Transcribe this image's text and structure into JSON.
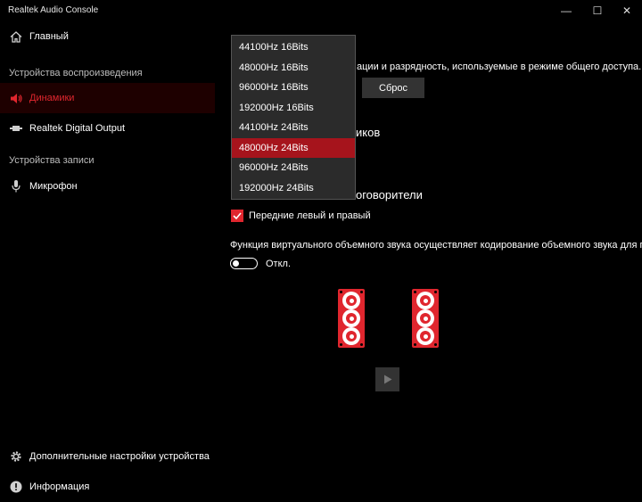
{
  "window": {
    "title": "Realtek Audio Console",
    "controls": [
      "—",
      "☐",
      "✕"
    ]
  },
  "sidebar": {
    "home": {
      "label": "Главный",
      "icon": "home-icon"
    },
    "playback_section": "Устройства воспроизведения",
    "playback_items": [
      {
        "label": "Динамики",
        "icon": "speaker-icon",
        "active": true
      },
      {
        "label": "Realtek Digital Output",
        "icon": "digital-output-icon",
        "active": false
      }
    ],
    "record_section": "Устройства записи",
    "record_items": [
      {
        "label": "Микрофон",
        "icon": "microphone-icon"
      }
    ],
    "bottom_items": [
      {
        "label": "Дополнительные настройки устройства",
        "icon": "gear-icon"
      },
      {
        "label": "Информация",
        "icon": "info-icon"
      }
    ]
  },
  "main": {
    "format_description": "ации и разрядность, используемые в режиме общего доступа.",
    "reset_label": "Сброс",
    "speaker_config_heading_partial": "иков",
    "fullrange_heading_partial": "оговорители",
    "front_lr_checkbox": {
      "label": "Передние левый и правый",
      "checked": true
    },
    "virtual_surround_text": "Функция виртуального объемного звука осуществляет кодирование объемного звука для пере",
    "virtual_surround_toggle": {
      "label": "Откл.",
      "on": false
    }
  },
  "format_dropdown": {
    "options": [
      "44100Hz 16Bits",
      "48000Hz 16Bits",
      "96000Hz 16Bits",
      "192000Hz 16Bits",
      "44100Hz 24Bits",
      "48000Hz 24Bits",
      "96000Hz 24Bits",
      "192000Hz 24Bits"
    ],
    "selected": "48000Hz 24Bits"
  },
  "colors": {
    "accent": "#e0262e",
    "selected_option": "#a6141c",
    "background": "#000000",
    "dropdown_bg": "#2b2b2b"
  }
}
